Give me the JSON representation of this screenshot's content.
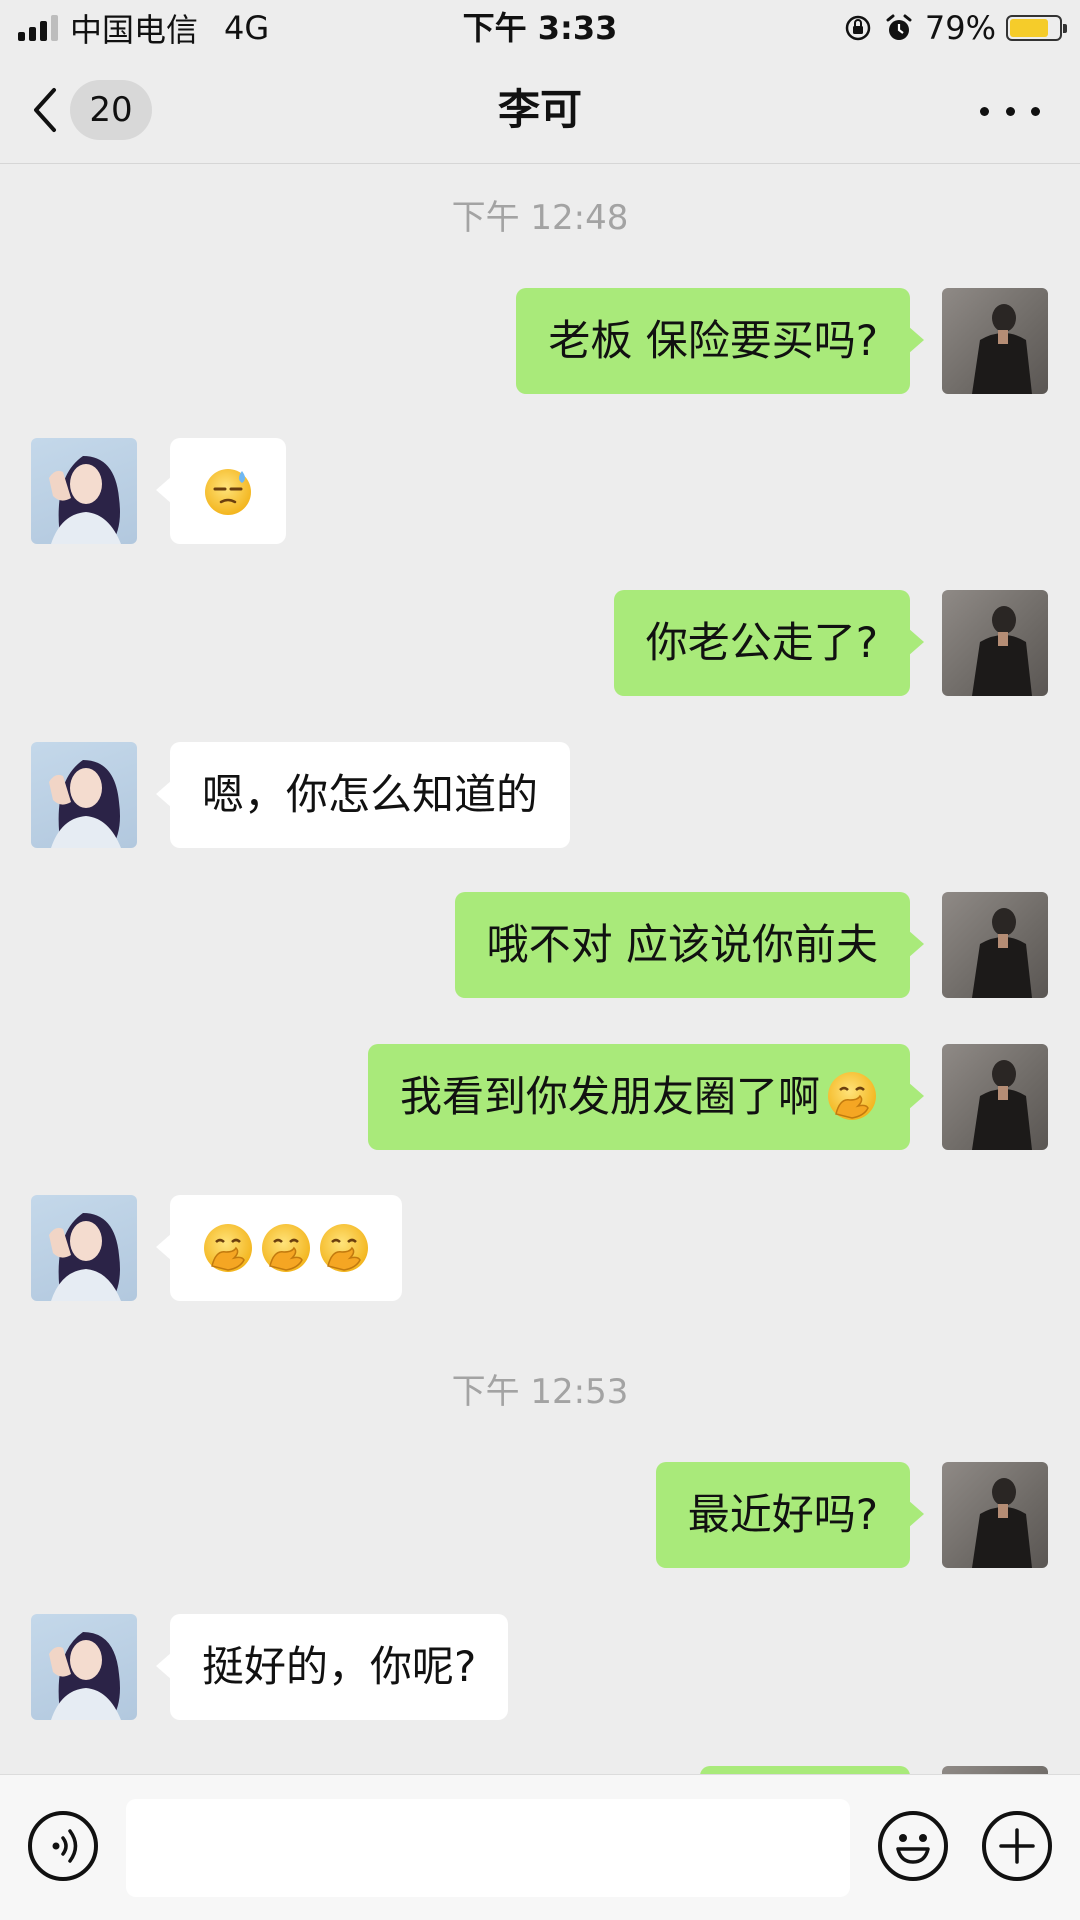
{
  "status_bar": {
    "carrier": "中国电信",
    "network": "4G",
    "time": "下午 3:33",
    "battery_percent": "79%",
    "battery_level": 0.79,
    "icons": [
      "signal-icon",
      "orientation-lock-icon",
      "alarm-icon",
      "battery-charging-icon"
    ]
  },
  "nav": {
    "unread_count": "20",
    "title": "李可",
    "icons": [
      "back-chevron-icon",
      "more-dots-icon"
    ]
  },
  "chat": {
    "timestamps": [
      "下午 12:48",
      "下午 12:53"
    ],
    "messages": [
      {
        "side": "right",
        "text": "老板 保险要买吗?"
      },
      {
        "side": "left",
        "text": "",
        "emojis": [
          "sweat-smile-emoji"
        ]
      },
      {
        "side": "right",
        "text": "你老公走了?"
      },
      {
        "side": "left",
        "text": "嗯，你怎么知道的"
      },
      {
        "side": "right",
        "text": "哦不对 应该说你前夫"
      },
      {
        "side": "right",
        "text": "我看到你发朋友圈了啊",
        "emojis": [
          "hand-over-mouth-emoji"
        ]
      },
      {
        "side": "left",
        "text": "",
        "emojis": [
          "hand-over-mouth-emoji",
          "hand-over-mouth-emoji",
          "hand-over-mouth-emoji"
        ]
      },
      {
        "side": "right",
        "text": "最近好吗?"
      },
      {
        "side": "left",
        "text": "挺好的，你呢?"
      }
    ]
  },
  "input_bar": {
    "value": "",
    "icons": [
      "voice-icon",
      "emoji-face-icon",
      "plus-icon"
    ]
  },
  "colors": {
    "background": "#ededed",
    "sent_bubble": "#a9ea7a",
    "received_bubble": "#ffffff",
    "timestamp_text": "#a3a3a3"
  }
}
